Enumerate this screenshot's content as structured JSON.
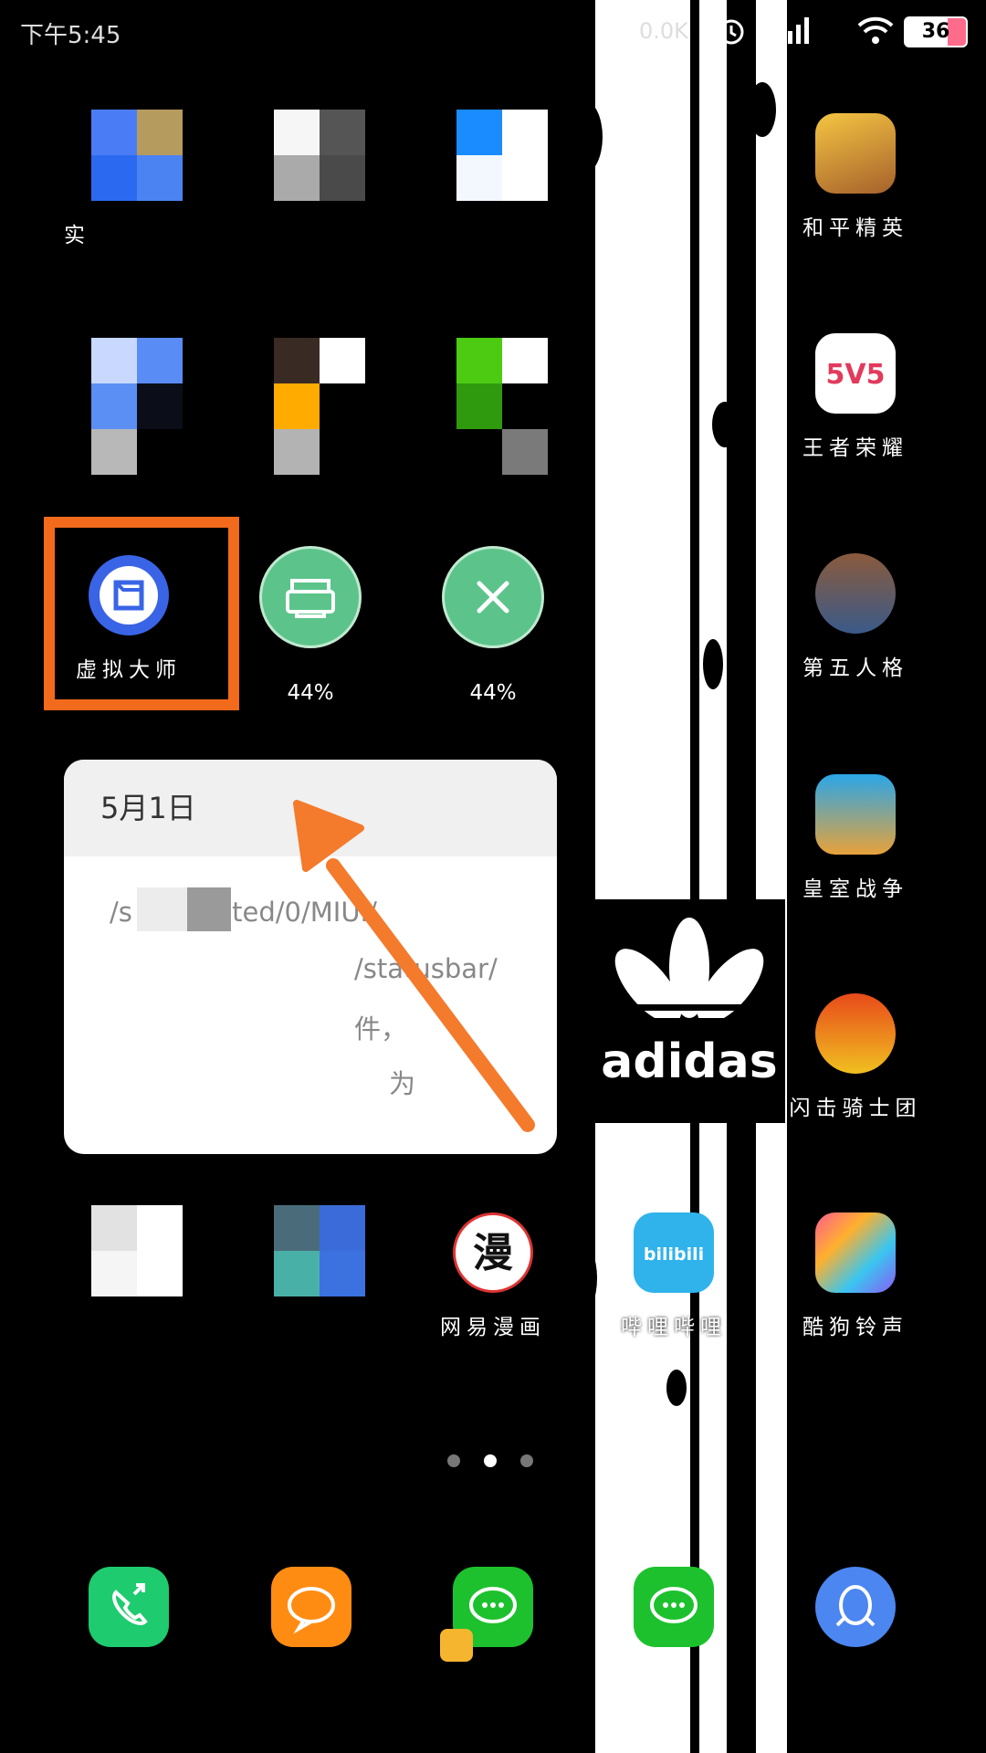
{
  "status_bar": {
    "time": "下午5:45",
    "net_speed": "0.0K",
    "battery": "36"
  },
  "apps": {
    "row1": [
      {
        "label": "实"
      },
      {
        "label": ""
      },
      {
        "label": ""
      },
      {
        "label": "和平精英"
      }
    ],
    "row2_right": {
      "label": "王者荣耀"
    },
    "row3": [
      {
        "label": "虚拟大师"
      },
      {
        "label": "44%"
      },
      {
        "label": "44%"
      },
      {
        "label": "第五人格"
      }
    ],
    "right_col": [
      {
        "label": "皇室战争"
      },
      {
        "label": "闪击骑士团"
      }
    ],
    "row_bottom": [
      {
        "label": ""
      },
      {
        "label": ""
      },
      {
        "label": "网易漫画"
      },
      {
        "label": "哔哩哔哩"
      },
      {
        "label": "酷狗铃声"
      }
    ]
  },
  "notification": {
    "date": "5月1日",
    "lines": [
      "/s       /emulated/0/MIUI/",
      "/statusbar/",
      "件，",
      "为"
    ]
  },
  "brand": {
    "logo_text": "adidas"
  },
  "colors": {
    "highlight": "#f26a1c",
    "arrow": "#f47a2c",
    "task_green": "#5cc48b"
  },
  "dock": [
    {
      "icon": "phone-icon"
    },
    {
      "icon": "message-icon"
    },
    {
      "icon": "wechat-icon"
    },
    {
      "icon": "wechat-icon"
    },
    {
      "icon": "qq-icon"
    }
  ]
}
